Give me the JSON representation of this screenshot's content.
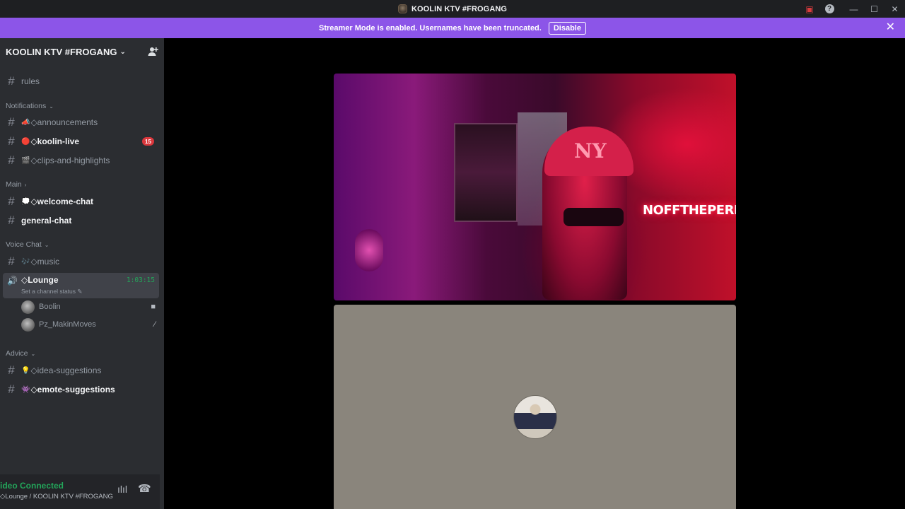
{
  "titlebar": {
    "title": "KOOLIN KTV #FROGANG",
    "icons": [
      "inbox-icon",
      "help-icon",
      "minimize-icon",
      "maximize-icon",
      "close-icon"
    ]
  },
  "banner": {
    "message": "Streamer Mode is enabled. Usernames have been truncated.",
    "disable_label": "Disable",
    "color": "#8c55e8"
  },
  "sidebar": {
    "server_name": "KOOLIN KTV #FROGANG",
    "rules": "rules",
    "categories": {
      "notifications": "Notifications",
      "main": "Main",
      "voice_chat": "Voice Chat",
      "advice": "Advice"
    },
    "channels": {
      "announcements": "◇announcements",
      "koolin_live": "◇koolin-live",
      "koolin_live_badge": "15",
      "clips": "◇clips-and-highlights",
      "welcome_chat": "◇welcome-chat",
      "general_chat": "general-chat",
      "music": "◇music",
      "idea_suggestions": "◇idea-suggestions",
      "emote_suggestions": "◇emote-suggestions"
    },
    "voice_channel": {
      "name": "◇Lounge",
      "timer": "1:03:15",
      "status_placeholder": "Set a channel status",
      "users": [
        {
          "name": "Boolin",
          "icon": "camera-icon"
        },
        {
          "name": "Pz_MakinMoves",
          "icon": "deafen-icon"
        }
      ]
    }
  },
  "voice_bar": {
    "connection": "ideo Connected",
    "location": "◇Lounge / KOOLIN KTV #FROGANG"
  },
  "stage": {
    "neon_sign": "NOFFTHEPERKY",
    "cap_logo": "NY"
  },
  "colors": {
    "accent_green": "#23a55a",
    "unread_badge": "#da373c",
    "sidebar_bg": "#2b2d31"
  }
}
